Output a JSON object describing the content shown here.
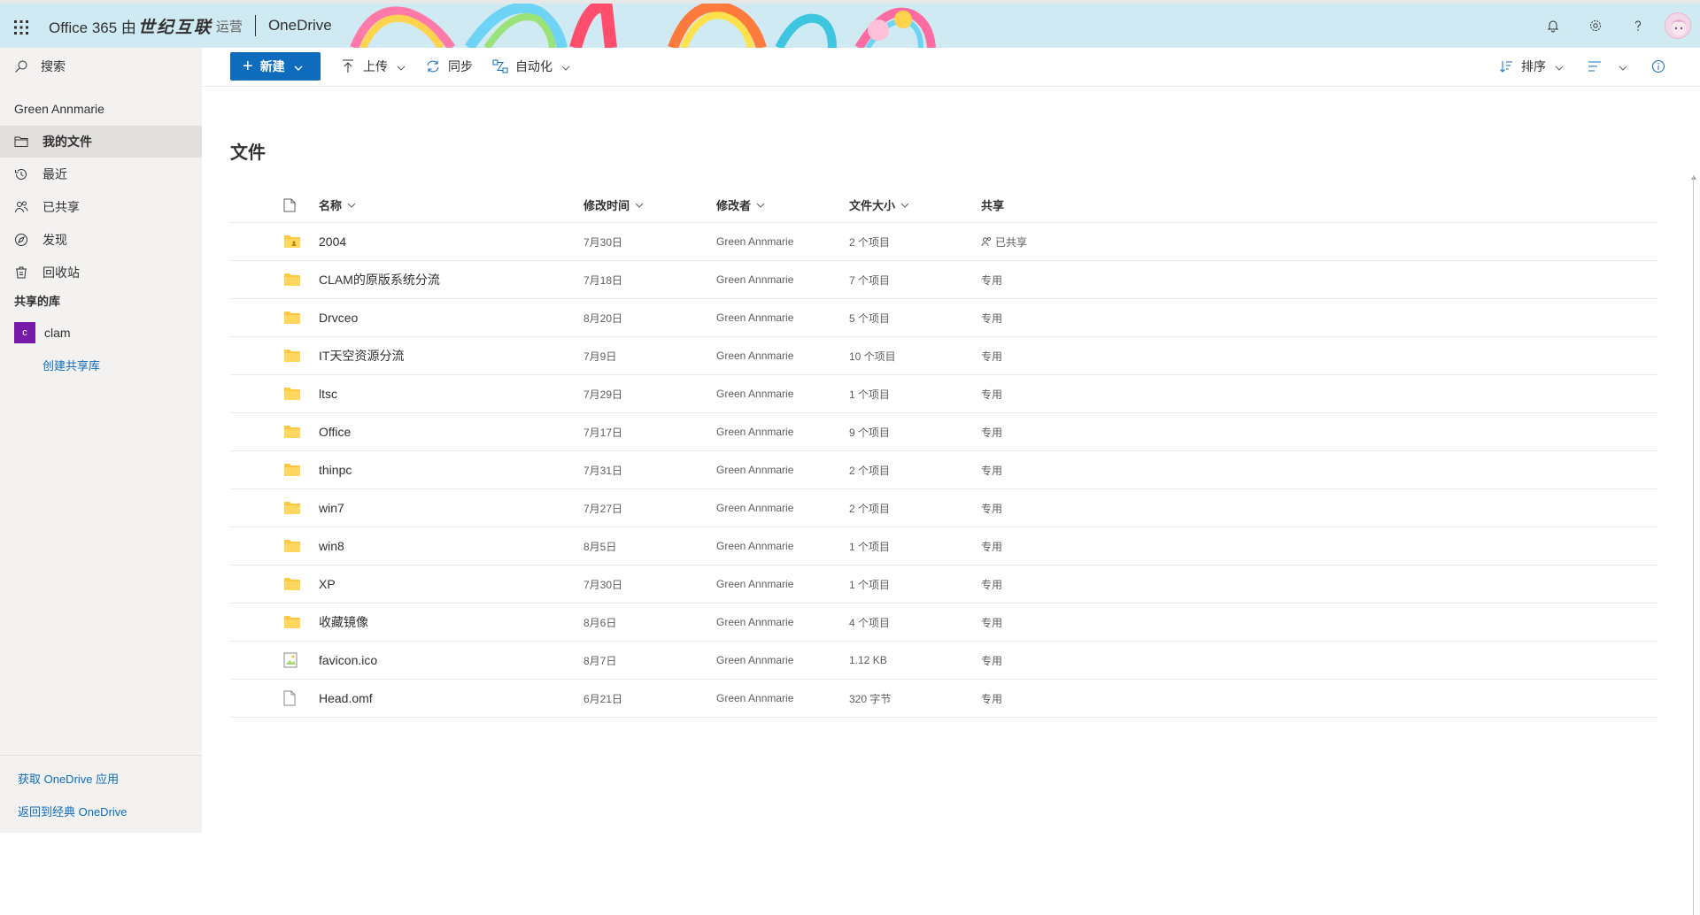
{
  "suite": {
    "brand_prefix": "Office 365 由",
    "operator": "世纪互联",
    "operator_suffix": "运营",
    "app_name": "OneDrive"
  },
  "nav": {
    "search": "搜索",
    "user": "Green Annmarie",
    "items": [
      {
        "label": "我的文件",
        "icon": "folder-icon"
      },
      {
        "label": "最近",
        "icon": "history-icon"
      },
      {
        "label": "已共享",
        "icon": "people-icon"
      },
      {
        "label": "发现",
        "icon": "discover-icon"
      },
      {
        "label": "回收站",
        "icon": "recycle-bin-icon"
      }
    ],
    "shared_libraries_heading": "共享的库",
    "library": {
      "badge": "c",
      "name": "clam",
      "color": "#7719aa"
    },
    "create_library": "创建共享库",
    "get_app": "获取 OneDrive 应用",
    "classic": "返回到经典 OneDrive"
  },
  "commands": {
    "new": "新建",
    "upload": "上传",
    "sync": "同步",
    "automate": "自动化",
    "sort": "排序"
  },
  "main": {
    "title": "文件",
    "columns": {
      "name": "名称",
      "modified": "修改时间",
      "modified_by": "修改者",
      "size": "文件大小",
      "sharing": "共享"
    },
    "rows": [
      {
        "type": "folder-shared",
        "name": "2004",
        "modified": "7月30日",
        "by": "Green Annmarie",
        "size": "2 个项目",
        "sharing": "已共享"
      },
      {
        "type": "folder",
        "name": "CLAM的原版系统分流",
        "modified": "7月18日",
        "by": "Green Annmarie",
        "size": "7 个项目",
        "sharing": "专用"
      },
      {
        "type": "folder",
        "name": "Drvceo",
        "modified": "8月20日",
        "by": "Green Annmarie",
        "size": "5 个项目",
        "sharing": "专用"
      },
      {
        "type": "folder",
        "name": "IT天空资源分流",
        "modified": "7月9日",
        "by": "Green Annmarie",
        "size": "10 个项目",
        "sharing": "专用"
      },
      {
        "type": "folder",
        "name": "ltsc",
        "modified": "7月29日",
        "by": "Green Annmarie",
        "size": "1 个项目",
        "sharing": "专用"
      },
      {
        "type": "folder",
        "name": "Office",
        "modified": "7月17日",
        "by": "Green Annmarie",
        "size": "9 个项目",
        "sharing": "专用"
      },
      {
        "type": "folder",
        "name": "thinpc",
        "modified": "7月31日",
        "by": "Green Annmarie",
        "size": "2 个项目",
        "sharing": "专用"
      },
      {
        "type": "folder",
        "name": "win7",
        "modified": "7月27日",
        "by": "Green Annmarie",
        "size": "2 个项目",
        "sharing": "专用"
      },
      {
        "type": "folder",
        "name": "win8",
        "modified": "8月5日",
        "by": "Green Annmarie",
        "size": "1 个项目",
        "sharing": "专用"
      },
      {
        "type": "folder",
        "name": "XP",
        "modified": "7月30日",
        "by": "Green Annmarie",
        "size": "1 个项目",
        "sharing": "专用"
      },
      {
        "type": "folder",
        "name": "收藏镜像",
        "modified": "8月6日",
        "by": "Green Annmarie",
        "size": "4 个项目",
        "sharing": "专用"
      },
      {
        "type": "image",
        "name": "favicon.ico",
        "modified": "8月7日",
        "by": "Green Annmarie",
        "size": "1.12 KB",
        "sharing": "专用"
      },
      {
        "type": "file",
        "name": "Head.omf",
        "modified": "6月21日",
        "by": "Green Annmarie",
        "size": "320 字节",
        "sharing": "专用"
      }
    ]
  },
  "colors": {
    "accent": "#0f6cbd",
    "folder": "#ffc83d",
    "header_bg": "#cfeaf2",
    "nav_bg": "#f3f2f1"
  }
}
